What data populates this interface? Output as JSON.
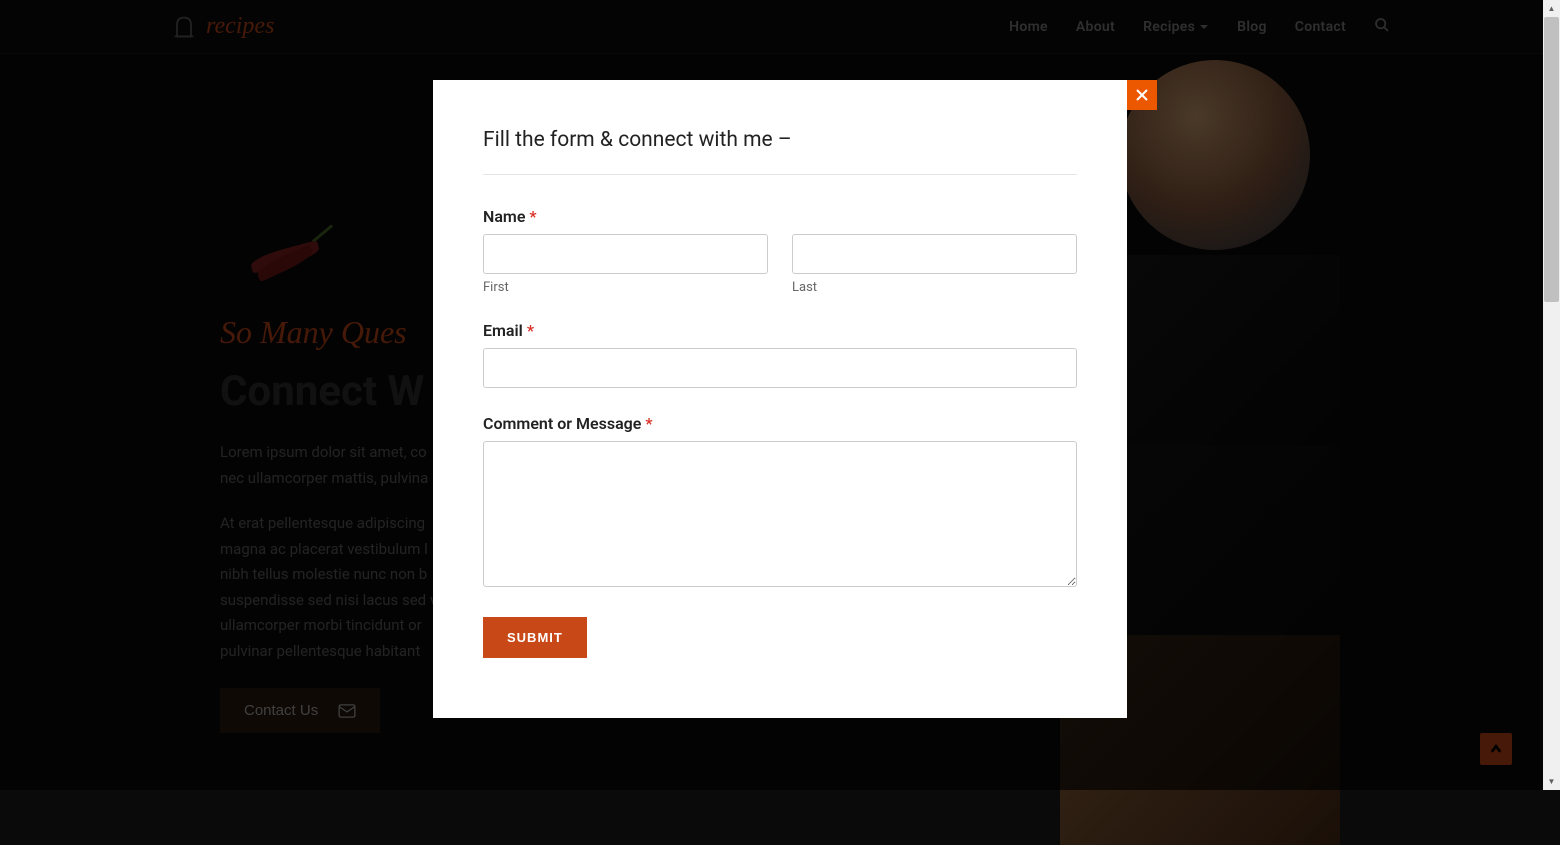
{
  "header": {
    "logo_text": "recipes",
    "nav": {
      "home": "Home",
      "about": "About",
      "recipes": "Recipes",
      "blog": "Blog",
      "contact": "Contact"
    }
  },
  "page": {
    "subtitle": "So Many Ques",
    "title": "Connect W",
    "para1": "Lorem ipsum dolor sit amet, co",
    "para1b": "nec ullamcorper mattis, pulvina",
    "para2": "At erat pellentesque adipiscing",
    "para2b": "magna ac placerat vestibulum l",
    "para2c": "nibh tellus molestie nunc non b",
    "para2d": "suspendisse sed nisi lacus sed v",
    "para2e": "ullamcorper morbi tincidunt or",
    "para2f": "pulvinar pellentesque habitant",
    "contact_btn": "Contact Us"
  },
  "modal": {
    "title": "Fill the form & connect with me –",
    "name_label": "Name ",
    "first_label": "First",
    "last_label": "Last",
    "email_label": "Email ",
    "comment_label": "Comment or Message ",
    "submit_label": "SUBMIT",
    "required": "*"
  }
}
